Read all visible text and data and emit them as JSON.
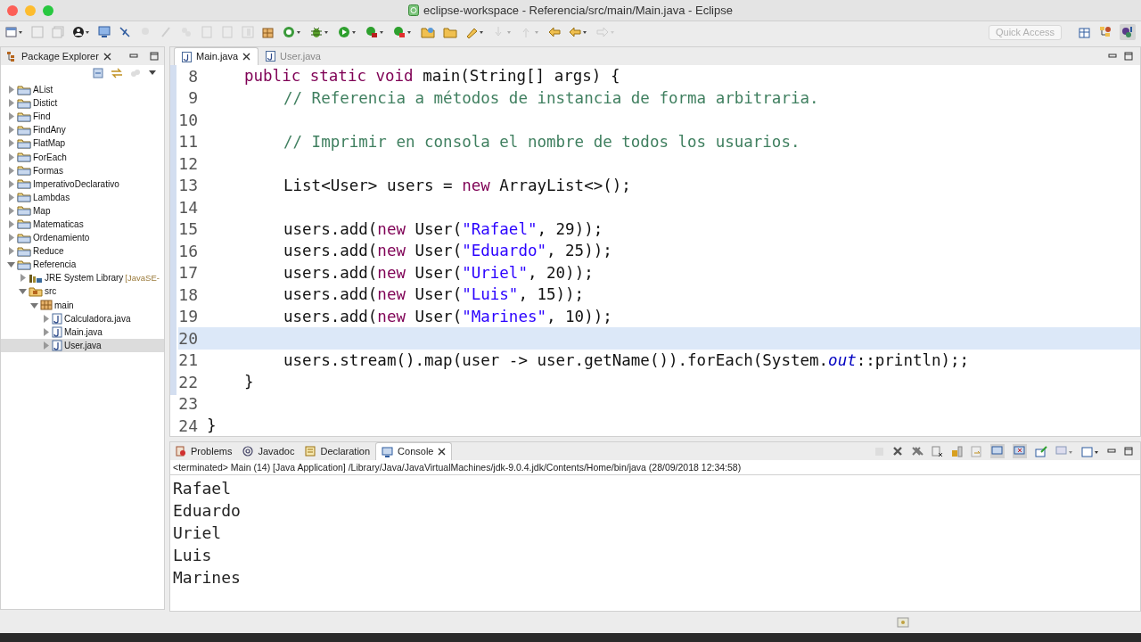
{
  "window": {
    "title": "eclipse-workspace - Referencia/src/main/Main.java - Eclipse"
  },
  "toolbar": {
    "quick_access": {
      "placeholder": "Quick Access"
    }
  },
  "package_explorer": {
    "title": "Package Explorer",
    "tree": [
      {
        "label": "AList",
        "kind": "project",
        "expanded": false,
        "selected": false
      },
      {
        "label": "Distict",
        "kind": "project",
        "expanded": false,
        "selected": false
      },
      {
        "label": "Find",
        "kind": "project",
        "expanded": false,
        "selected": false
      },
      {
        "label": "FindAny",
        "kind": "project",
        "expanded": false,
        "selected": false
      },
      {
        "label": "FlatMap",
        "kind": "project",
        "expanded": false,
        "selected": false
      },
      {
        "label": "ForEach",
        "kind": "project",
        "expanded": false,
        "selected": false
      },
      {
        "label": "Formas",
        "kind": "project",
        "expanded": false,
        "selected": false
      },
      {
        "label": "ImperativoDeclarativo",
        "kind": "project",
        "expanded": false,
        "selected": false
      },
      {
        "label": "Lambdas",
        "kind": "project",
        "expanded": false,
        "selected": false
      },
      {
        "label": "Map",
        "kind": "project",
        "expanded": false,
        "selected": false
      },
      {
        "label": "Matematicas",
        "kind": "project",
        "expanded": false,
        "selected": false
      },
      {
        "label": "Ordenamiento",
        "kind": "project",
        "expanded": false,
        "selected": false
      },
      {
        "label": "Reduce",
        "kind": "project",
        "expanded": false,
        "selected": false
      },
      {
        "label": "Referencia",
        "kind": "project",
        "expanded": true,
        "selected": false,
        "children": [
          {
            "label": "JRE System Library",
            "decoration": "[JavaSE-",
            "kind": "library",
            "expanded": false,
            "selected": false
          },
          {
            "label": "src",
            "kind": "source_folder",
            "expanded": true,
            "selected": false,
            "children": [
              {
                "label": "main",
                "kind": "package",
                "expanded": true,
                "selected": false,
                "children": [
                  {
                    "label": "Calculadora.java",
                    "kind": "java_file",
                    "expanded": false,
                    "selected": false
                  },
                  {
                    "label": "Main.java",
                    "kind": "java_file",
                    "expanded": false,
                    "selected": false
                  },
                  {
                    "label": "User.java",
                    "kind": "java_file",
                    "expanded": false,
                    "selected": true
                  }
                ]
              }
            ]
          }
        ]
      }
    ]
  },
  "editor": {
    "tabs": [
      {
        "label": "Main.java",
        "selected": true
      },
      {
        "label": "User.java",
        "selected": false
      }
    ],
    "lines": [
      {
        "number": "8",
        "current": false,
        "kind": "method",
        "tokens": [
          {
            "kind": "keyword",
            "text": "public static void"
          },
          {
            "kind": "plain",
            "text": " main(String[] args) {"
          }
        ]
      },
      {
        "number": "9",
        "current": false,
        "kind": "body",
        "tokens": [
          {
            "kind": "comment",
            "text": "// Referencia a métodos de instancia de forma arbitraria."
          }
        ]
      },
      {
        "number": "10",
        "current": false
      },
      {
        "number": "11",
        "current": false,
        "kind": "body",
        "tokens": [
          {
            "kind": "comment",
            "text": "// Imprimir en consola el nombre de todos los usuarios."
          }
        ]
      },
      {
        "number": "12",
        "current": false
      },
      {
        "number": "13",
        "current": false,
        "kind": "body",
        "tokens": [
          {
            "kind": "plain",
            "text": "List<User> users = "
          },
          {
            "kind": "keyword",
            "text": "new"
          },
          {
            "kind": "plain",
            "text": " ArrayList<>();"
          }
        ]
      },
      {
        "number": "14",
        "current": false
      },
      {
        "number": "15",
        "current": false,
        "kind": "body",
        "tokens": [
          {
            "kind": "plain",
            "text": "users.add("
          },
          {
            "kind": "keyword",
            "text": "new"
          },
          {
            "kind": "plain",
            "text": " User("
          },
          {
            "kind": "string",
            "text": "\"Rafael\""
          },
          {
            "kind": "plain",
            "text": ", 29));"
          }
        ]
      },
      {
        "number": "16",
        "current": false,
        "kind": "body",
        "tokens": [
          {
            "kind": "plain",
            "text": "users.add("
          },
          {
            "kind": "keyword",
            "text": "new"
          },
          {
            "kind": "plain",
            "text": " User("
          },
          {
            "kind": "string",
            "text": "\"Eduardo\""
          },
          {
            "kind": "plain",
            "text": ", 25));"
          }
        ]
      },
      {
        "number": "17",
        "current": false,
        "kind": "body",
        "tokens": [
          {
            "kind": "plain",
            "text": "users.add("
          },
          {
            "kind": "keyword",
            "text": "new"
          },
          {
            "kind": "plain",
            "text": " User("
          },
          {
            "kind": "string",
            "text": "\"Uriel\""
          },
          {
            "kind": "plain",
            "text": ", 20));"
          }
        ]
      },
      {
        "number": "18",
        "current": false,
        "kind": "body",
        "tokens": [
          {
            "kind": "plain",
            "text": "users.add("
          },
          {
            "kind": "keyword",
            "text": "new"
          },
          {
            "kind": "plain",
            "text": " User("
          },
          {
            "kind": "string",
            "text": "\"Luis\""
          },
          {
            "kind": "plain",
            "text": ", 15));"
          }
        ]
      },
      {
        "number": "19",
        "current": false,
        "kind": "body",
        "tokens": [
          {
            "kind": "plain",
            "text": "users.add("
          },
          {
            "kind": "keyword",
            "text": "new"
          },
          {
            "kind": "plain",
            "text": " User("
          },
          {
            "kind": "string",
            "text": "\"Marines\""
          },
          {
            "kind": "plain",
            "text": ", 10));"
          }
        ]
      },
      {
        "number": "20",
        "current": true
      },
      {
        "number": "21",
        "current": false,
        "kind": "body",
        "tokens": [
          {
            "kind": "plain",
            "text": "users.stream().map(user -> user.getName()).forEach(System."
          },
          {
            "kind": "static_field",
            "text": "out"
          },
          {
            "kind": "plain",
            "text": "::println);;"
          }
        ]
      },
      {
        "number": "22",
        "current": false,
        "kind": "method",
        "tokens": [
          {
            "kind": "plain",
            "text": "}"
          }
        ]
      },
      {
        "number": "23",
        "current": false
      },
      {
        "number": "24",
        "current": false,
        "kind": "class",
        "tokens": [
          {
            "kind": "plain",
            "text": "}"
          }
        ]
      }
    ]
  },
  "bottom_panel": {
    "tabs": [
      {
        "label": "Problems",
        "kind": "problems",
        "selected": false
      },
      {
        "label": "Javadoc",
        "kind": "javadoc",
        "selected": false
      },
      {
        "label": "Declaration",
        "kind": "declaration",
        "selected": false
      },
      {
        "label": "Console",
        "kind": "console",
        "selected": true
      }
    ],
    "status": "<terminated> Main (14) [Java Application] /Library/Java/JavaVirtualMachines/jdk-9.0.4.jdk/Contents/Home/bin/java (28/09/2018 12:34:58)",
    "output": [
      "Rafael",
      "Eduardo",
      "Uriel",
      "Luis",
      "Marines"
    ]
  }
}
